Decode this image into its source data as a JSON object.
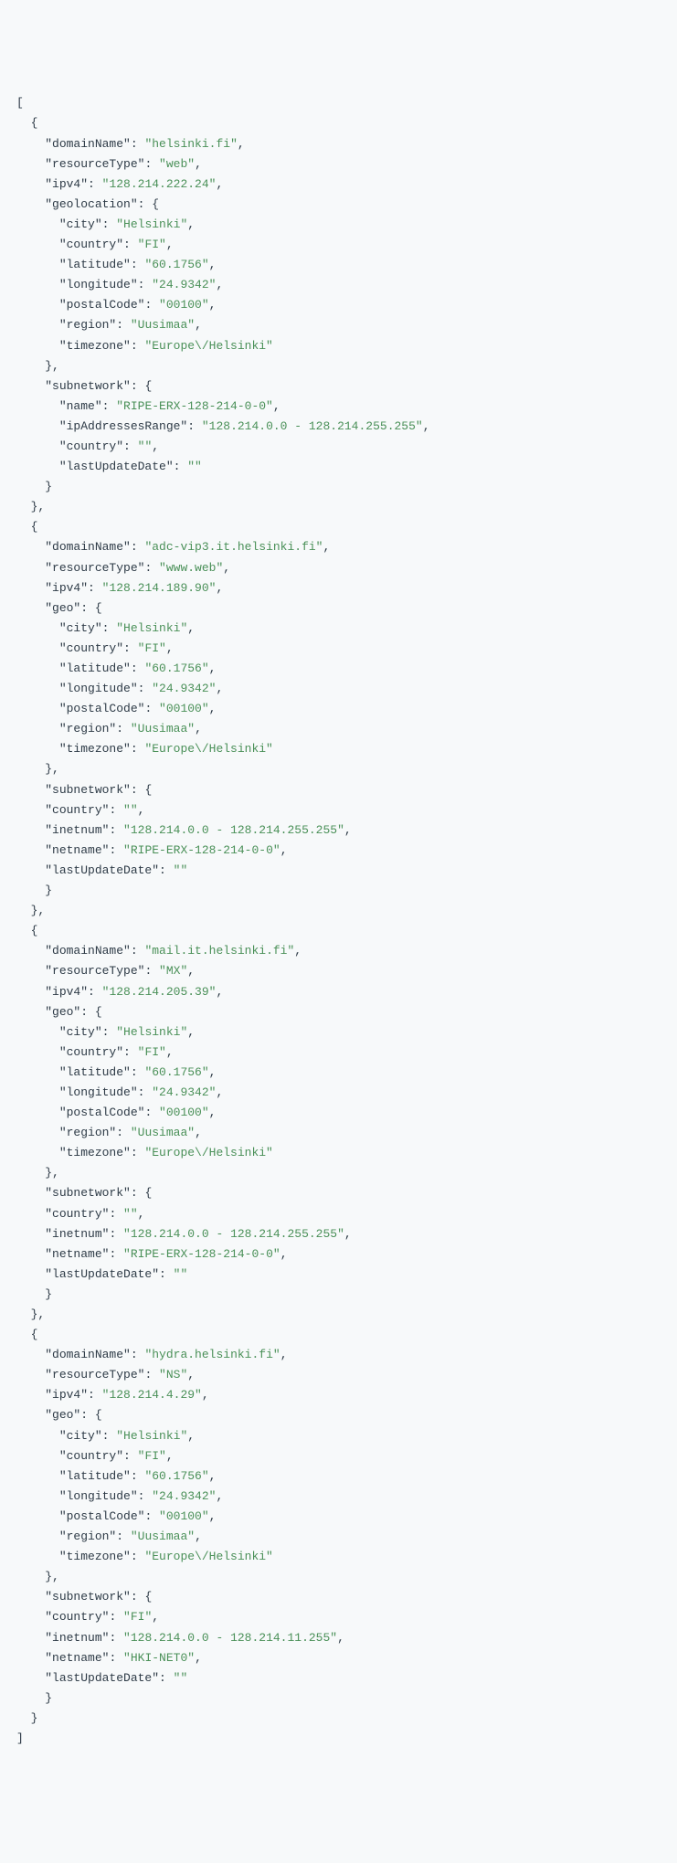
{
  "records": [
    {
      "domainName": "helsinki.fi",
      "resourceType": "web",
      "ipv4": "128.214.222.24",
      "geoKey": "geolocation",
      "geo": {
        "city": "Helsinki",
        "country": "FI",
        "latitude": "60.1756",
        "longitude": "24.9342",
        "postalCode": "00100",
        "region": "Uusimaa",
        "timezone": "Europe\\/Helsinki"
      },
      "subnetwork": {
        "fields": [
          {
            "key": "name",
            "value": "RIPE-ERX-128-214-0-0",
            "indent": 3
          },
          {
            "key": "ipAddressesRange",
            "value": "128.214.0.0 - 128.214.255.255",
            "indent": 3
          },
          {
            "key": "country",
            "value": "",
            "indent": 3
          },
          {
            "key": "lastUpdateDate",
            "value": "",
            "indent": 3
          }
        ]
      }
    },
    {
      "domainName": "adc-vip3.it.helsinki.fi",
      "resourceType": "www.web",
      "ipv4": "128.214.189.90",
      "geoKey": "geo",
      "geo": {
        "city": "Helsinki",
        "country": "FI",
        "latitude": "60.1756",
        "longitude": "24.9342",
        "postalCode": "00100",
        "region": "Uusimaa",
        "timezone": "Europe\\/Helsinki"
      },
      "subnetwork": {
        "fields": [
          {
            "key": "country",
            "value": "",
            "indent": 2
          },
          {
            "key": "inetnum",
            "value": "128.214.0.0 - 128.214.255.255",
            "indent": 2
          },
          {
            "key": "netname",
            "value": "RIPE-ERX-128-214-0-0",
            "indent": 2
          },
          {
            "key": "lastUpdateDate",
            "value": "",
            "indent": 2
          }
        ]
      }
    },
    {
      "domainName": "mail.it.helsinki.fi",
      "resourceType": "MX",
      "ipv4": "128.214.205.39",
      "geoKey": "geo",
      "geo": {
        "city": "Helsinki",
        "country": "FI",
        "latitude": "60.1756",
        "longitude": "24.9342",
        "postalCode": "00100",
        "region": "Uusimaa",
        "timezone": "Europe\\/Helsinki"
      },
      "subnetwork": {
        "fields": [
          {
            "key": "country",
            "value": "",
            "indent": 2
          },
          {
            "key": "inetnum",
            "value": "128.214.0.0 - 128.214.255.255",
            "indent": 2
          },
          {
            "key": "netname",
            "value": "RIPE-ERX-128-214-0-0",
            "indent": 2
          },
          {
            "key": "lastUpdateDate",
            "value": "",
            "indent": 2
          }
        ]
      }
    },
    {
      "domainName": "hydra.helsinki.fi",
      "resourceType": "NS",
      "ipv4": "128.214.4.29",
      "geoKey": "geo",
      "geo": {
        "city": "Helsinki",
        "country": "FI",
        "latitude": "60.1756",
        "longitude": "24.9342",
        "postalCode": "00100",
        "region": "Uusimaa",
        "timezone": "Europe\\/Helsinki"
      },
      "subnetwork": {
        "fields": [
          {
            "key": "country",
            "value": "FI",
            "indent": 2
          },
          {
            "key": "inetnum",
            "value": "128.214.0.0 - 128.214.11.255",
            "indent": 2
          },
          {
            "key": "netname",
            "value": "HKI-NET0",
            "indent": 2
          },
          {
            "key": "lastUpdateDate",
            "value": "",
            "indent": 2
          }
        ]
      }
    }
  ]
}
